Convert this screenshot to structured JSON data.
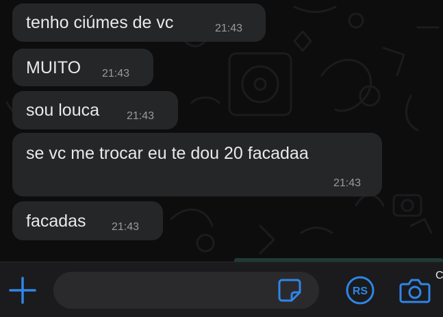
{
  "messages": [
    {
      "text": "tenho ciúmes de vc",
      "time": "21:43"
    },
    {
      "text": "MUITO",
      "time": "21:43"
    },
    {
      "text": "sou louca",
      "time": "21:43"
    },
    {
      "text": "se vc me trocar eu te dou 20 facadaa",
      "time": "21:43"
    },
    {
      "text": "facadas",
      "time": "21:43"
    }
  ],
  "composer": {
    "placeholder": ""
  },
  "icons": {
    "attach": "plus-icon",
    "sticker": "sticker-icon",
    "payments": "rs-payment-icon",
    "camera": "camera-icon"
  },
  "edge_text": "C",
  "colors": {
    "accent": "#2f86e8",
    "bubble": "#252628",
    "background": "#0d0d0e",
    "text": "#e9e9ea",
    "time": "#9a9b9e"
  }
}
